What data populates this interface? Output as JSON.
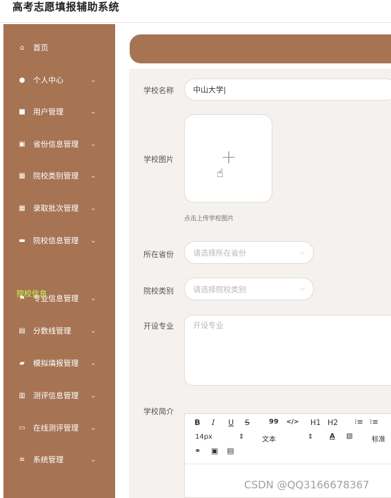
{
  "app": {
    "title": "高考志愿填报辅助系统"
  },
  "sidebar": {
    "items": [
      {
        "label": "首页",
        "icon": "home-icon",
        "glyph": "⌂",
        "has_chevron": false
      },
      {
        "label": "个人中心",
        "icon": "user-icon",
        "glyph": "●",
        "has_chevron": true
      },
      {
        "label": "用户管理",
        "icon": "user-manage-icon",
        "glyph": "■",
        "has_chevron": true
      },
      {
        "label": "省份信息管理",
        "icon": "clipboard-icon",
        "glyph": "▣",
        "has_chevron": true
      },
      {
        "label": "院校类别管理",
        "icon": "grid-icon",
        "glyph": "▦",
        "has_chevron": true
      },
      {
        "label": "录取批次管理",
        "icon": "grid-icon",
        "glyph": "▦",
        "has_chevron": true
      },
      {
        "label": "院校信息管理",
        "icon": "school-icon",
        "glyph": "▬",
        "has_chevron": true
      },
      {
        "label": "专业信息管理",
        "icon": "flag-icon",
        "glyph": "⚑",
        "has_chevron": true
      },
      {
        "label": "分数线管理",
        "icon": "chart-icon",
        "glyph": "▤",
        "has_chevron": true
      },
      {
        "label": "模拟填报管理",
        "icon": "chat-icon",
        "glyph": "▰",
        "has_chevron": true
      },
      {
        "label": "测评信息管理",
        "icon": "document-icon",
        "glyph": "▥",
        "has_chevron": true
      },
      {
        "label": "在线测评管理",
        "icon": "monitor-icon",
        "glyph": "▭",
        "has_chevron": true
      },
      {
        "label": "系统管理",
        "icon": "menu-icon",
        "glyph": "≡",
        "has_chevron": true
      }
    ],
    "sub_label": "院校信息",
    "chevron_glyph": "⌄"
  },
  "form": {
    "school_name_label": "学校名称",
    "school_name_value": "中山大学",
    "school_image_label": "学校图片",
    "upload_plus": "+",
    "upload_cursor": "☝",
    "upload_hint": "点击上传学校图片",
    "province_label": "所在省份",
    "province_placeholder": "请选择所在省份",
    "category_label": "院校类别",
    "category_placeholder": "请选择院校类别",
    "majors_label": "开设专业",
    "majors_placeholder": "开设专业",
    "intro_label": "学校简介"
  },
  "editor": {
    "bold": "B",
    "italic": "I",
    "underline": "U",
    "strike": "S",
    "quote": "99",
    "code": "</>",
    "h1": "H1",
    "h2": "H2",
    "ordered_list": "⁝≡",
    "bullet_list": "⁝≡",
    "font_size": "14px",
    "font_size_arrow": "⇕",
    "text_style": "文本",
    "text_style_arrow": "⇕",
    "font_color": "A",
    "background_color": "▧",
    "heading_style": "标准",
    "link": "⚭",
    "image": "▣",
    "video": "▤"
  },
  "watermark": "CSDN @QQ3166678367"
}
